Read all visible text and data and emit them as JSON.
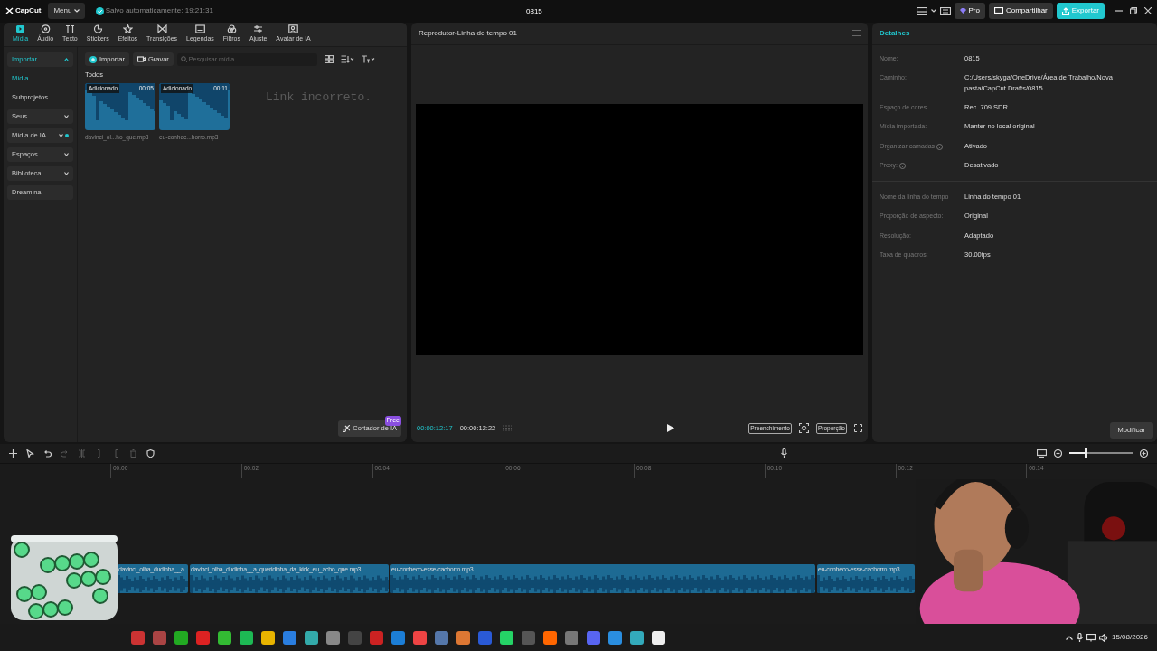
{
  "app": {
    "logo": "CapCut",
    "menu": "Menu",
    "autosave": "Salvo automaticamente: 19:21:31",
    "project": "0815"
  },
  "header_buttons": [
    {
      "label": "Pro",
      "kind": "pro"
    },
    {
      "label": "Compartilhar",
      "kind": "share"
    },
    {
      "label": "Exportar",
      "kind": "export"
    }
  ],
  "toolbar_tabs": [
    {
      "label": "Mídia",
      "selected": true
    },
    {
      "label": "Áudio",
      "selected": false
    },
    {
      "label": "Texto",
      "selected": false
    },
    {
      "label": "Stickers",
      "selected": false
    },
    {
      "label": "Efeitos",
      "selected": false
    },
    {
      "label": "Transições",
      "selected": false
    },
    {
      "label": "Legendas",
      "selected": false
    },
    {
      "label": "Filtros",
      "selected": false
    },
    {
      "label": "Ajuste",
      "selected": false
    },
    {
      "label": "Avatar de IA",
      "selected": false
    }
  ],
  "sidebar": [
    {
      "label": "Importar",
      "kind": "group",
      "expanded": true,
      "notification": false
    },
    {
      "label": "Mídia",
      "kind": "sub",
      "selected": true
    },
    {
      "label": "Subprojetos",
      "kind": "sub",
      "selected": false
    },
    {
      "label": "Seus",
      "kind": "group",
      "expanded": false,
      "notification": false
    },
    {
      "label": "Mídia de IA",
      "kind": "group",
      "expanded": false,
      "notification": true
    },
    {
      "label": "Espaços",
      "kind": "group",
      "expanded": false,
      "notification": false
    },
    {
      "label": "Biblioteca",
      "kind": "group",
      "expanded": false,
      "notification": false
    },
    {
      "label": "Dreamina",
      "kind": "plain"
    }
  ],
  "media": {
    "import": "Importar",
    "record": "Gravar",
    "search": {
      "placeholder": "Pesquisar mídia"
    },
    "section": "Todos",
    "items": [
      {
        "tag": "Adicionado",
        "duration": "00:05",
        "filename": "davinci_ol...ho_que.mp3"
      },
      {
        "tag": "Adicionado",
        "duration": "00:11",
        "filename": "eu-conhec...horro.mp3"
      }
    ],
    "overlay_text": "Link incorreto.",
    "ai_cutter": "Cortador de IA",
    "ai_badge": "Free"
  },
  "player": {
    "title": "Reprodutor-Linha do tempo 01",
    "current": "00:00:12:17",
    "total": "00:00:12:22",
    "fill": "Preenchimento",
    "ratio": "Proporção"
  },
  "details": {
    "title": "Detalhes",
    "groups": [
      [
        {
          "label": "Nome:",
          "value": "0815",
          "help": false
        },
        {
          "label": "Caminho:",
          "value": "C:/Users/skyga/OneDrive/Área de Trabalho/Nova pasta/CapCut Drafts/0815",
          "help": false
        },
        {
          "label": "Espaço de cores",
          "value": "Rec. 709 SDR",
          "help": false
        },
        {
          "label": "Mídia importada:",
          "value": "Manter no local original",
          "help": false
        },
        {
          "label": "Organizar camadas",
          "value": "Ativado",
          "help": true
        },
        {
          "label": "Proxy:",
          "value": "Desativado",
          "help": true
        }
      ],
      [
        {
          "label": "Nome da linha do tempo",
          "value": "Linha do tempo 01",
          "help": false
        },
        {
          "label": "Proporção de aspecto:",
          "value": "Original",
          "help": false
        },
        {
          "label": "Resolução:",
          "value": "Adaptado",
          "help": false
        },
        {
          "label": "Taxa de quadros:",
          "value": "30.00fps",
          "help": false
        }
      ]
    ],
    "modify": "Modificar"
  },
  "timeline": {
    "ticks": [
      "00:00",
      "00:02",
      "00:04",
      "00:06",
      "00:08",
      "00:10",
      "00:12",
      "00:14"
    ],
    "zoom": {
      "level": 0.25
    },
    "clips": [
      {
        "label": "davinci_olha_dudinha__a"
      },
      {
        "label": "davinci_olha_dudinha__a_queridinha_da_kick_eu_acho_que.mp3"
      },
      {
        "label": "eu-conheco-esse-cachorro.mp3"
      },
      {
        "label": "eu-conheco-esse-cachorro.mp3"
      }
    ]
  },
  "taskbar": {
    "date": "15/08/2026"
  }
}
